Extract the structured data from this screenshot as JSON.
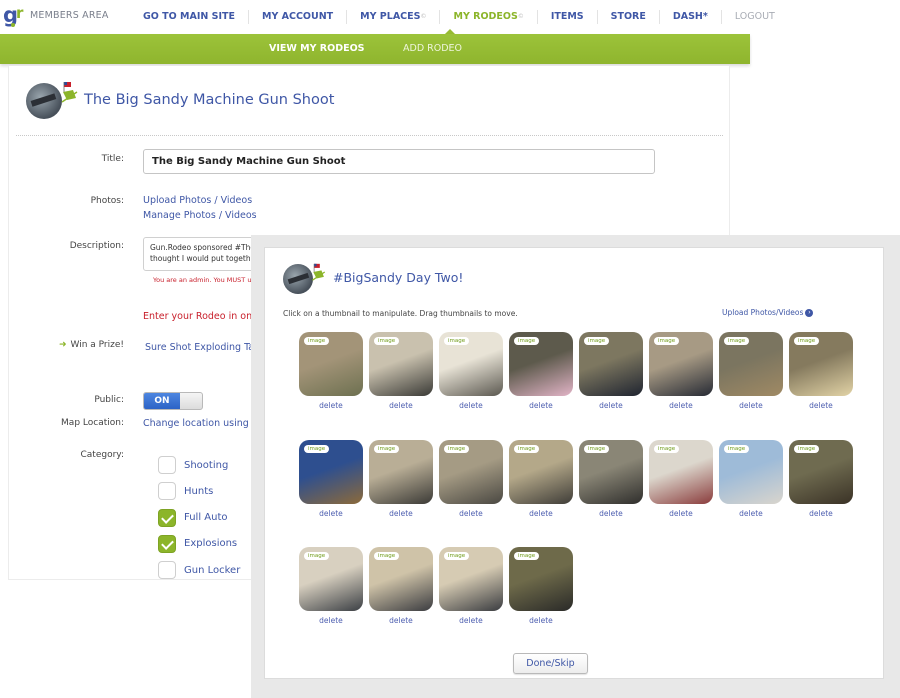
{
  "header": {
    "logo_text": "MEMBERS AREA",
    "nav": [
      {
        "label": "GO TO MAIN SITE",
        "mark": "",
        "state": "normal"
      },
      {
        "label": "MY ACCOUNT",
        "mark": "",
        "state": "normal"
      },
      {
        "label": "MY PLACES",
        "mark": "©",
        "state": "normal"
      },
      {
        "label": "MY RODEOS",
        "mark": "©",
        "state": "active"
      },
      {
        "label": "ITEMS",
        "mark": "",
        "state": "normal"
      },
      {
        "label": "STORE",
        "mark": "",
        "state": "normal"
      },
      {
        "label": "DASH*",
        "mark": "",
        "state": "normal"
      },
      {
        "label": "LOGOUT",
        "mark": "",
        "state": "muted"
      }
    ],
    "subnav": {
      "view": "VIEW MY RODEOS",
      "add": "ADD RODEO"
    }
  },
  "form": {
    "page_title": "The Big Sandy Machine Gun Shoot",
    "title_label": "Title:",
    "title_value": "The Big Sandy Machine Gun Shoot",
    "photos_label": "Photos:",
    "upload_link": "Upload Photos / Videos",
    "manage_link": "Manage Photos / Videos",
    "description_label": "Description:",
    "description_line1": "Gun.Rodeo sponsored #The",
    "description_line2": "thought I would put togeth",
    "admin_warning": "You are an admin. You MUST us",
    "enter_message": "Enter your Rodeo in one c",
    "prize_label": "Win a Prize!",
    "prize_link": "Sure Shot Exploding Tar",
    "public_label": "Public:",
    "public_toggle": "ON",
    "map_label": "Map Location:",
    "map_link": "Change location using a",
    "category_label": "Category:",
    "categories": [
      {
        "label": "Shooting",
        "checked": false
      },
      {
        "label": "Hunts",
        "checked": false
      },
      {
        "label": "Full Auto",
        "checked": true
      },
      {
        "label": "Explosions",
        "checked": true
      },
      {
        "label": "Gun Locker",
        "checked": false
      }
    ]
  },
  "modal": {
    "title": "#BigSandy Day Two!",
    "hint": "Click on a thumbnail to manipulate. Drag thumbnails to move.",
    "upload_link": "Upload Photos/Videos",
    "thumb_tag": "image",
    "delete_label": "delete",
    "thumbnails": [
      {
        "subject": "target-sign-in-brush",
        "colors": [
          "#a39478",
          "#6d7050"
        ]
      },
      {
        "subject": "machine-gun-desert",
        "colors": [
          "#c9c1ae",
          "#3a3a36"
        ]
      },
      {
        "subject": "mounted-gun-smoke",
        "colors": [
          "#e8e3d6",
          "#5b5850"
        ]
      },
      {
        "subject": "woman-with-rifle",
        "colors": [
          "#5d5a4c",
          "#e2b4c7"
        ]
      },
      {
        "subject": "man-aiming-rifle",
        "colors": [
          "#7d7760",
          "#1f2430"
        ]
      },
      {
        "subject": "man-aiming-rifle-2",
        "colors": [
          "#a79a84",
          "#262a34"
        ]
      },
      {
        "subject": "small-explosion",
        "colors": [
          "#7b7560",
          "#a08a64"
        ]
      },
      {
        "subject": "large-explosion",
        "colors": [
          "#857a5e",
          "#e2d3a6"
        ]
      },
      {
        "subject": "target-dummy",
        "colors": [
          "#2e4f8f",
          "#8c6a3a"
        ]
      },
      {
        "subject": "tripod-gun-1",
        "colors": [
          "#b9ae96",
          "#3b3a36"
        ]
      },
      {
        "subject": "tripod-gun-2",
        "colors": [
          "#a59b84",
          "#4a4842"
        ]
      },
      {
        "subject": "tripod-gun-3",
        "colors": [
          "#b4a889",
          "#3f3d38"
        ]
      },
      {
        "subject": "gun-on-sandbag",
        "colors": [
          "#8a8676",
          "#2f2e2c"
        ]
      },
      {
        "subject": "man-crouching-gun",
        "colors": [
          "#dcd7cd",
          "#8a3c3c"
        ]
      },
      {
        "subject": "smoke-cloud-gun",
        "colors": [
          "#9ebbd8",
          "#d9d5cd"
        ]
      },
      {
        "subject": "gun-table",
        "colors": [
          "#6f6b50",
          "#3a3226"
        ]
      },
      {
        "subject": "bearded-man-rifle",
        "colors": [
          "#d8d0c0",
          "#3b3f44"
        ]
      },
      {
        "subject": "men-rifle-1",
        "colors": [
          "#cfc3a8",
          "#3b3c40"
        ]
      },
      {
        "subject": "men-rifle-2",
        "colors": [
          "#d6cbb3",
          "#3a3c40"
        ]
      },
      {
        "subject": "gun-crew",
        "colors": [
          "#6e6a4a",
          "#2a2a28"
        ]
      }
    ],
    "done_button": "Done/Skip"
  }
}
